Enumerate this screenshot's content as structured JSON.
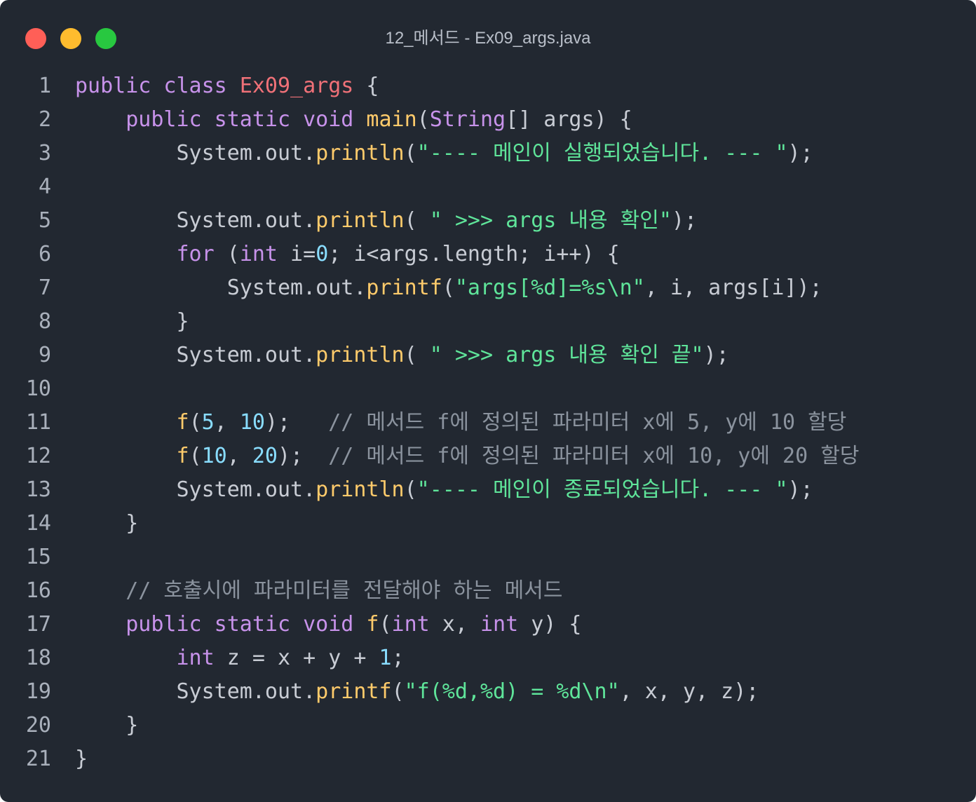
{
  "window": {
    "title": "12_메서드 - Ex09_args.java",
    "traffic_lights": [
      {
        "name": "close",
        "color": "#ff5f57"
      },
      {
        "name": "minimize",
        "color": "#febc2e"
      },
      {
        "name": "maximize",
        "color": "#28c840"
      }
    ]
  },
  "colors": {
    "background": "#222831",
    "keyword": "#c792ea",
    "class_name": "#f07178",
    "function": "#ffcb6b",
    "string": "#5fe59a",
    "number": "#89ddff",
    "comment": "#8b939e",
    "plain": "#c8ccd4"
  },
  "code": {
    "lines": [
      {
        "n": "1",
        "tokens": [
          {
            "t": "public class ",
            "k": "kw"
          },
          {
            "t": "Ex09_args",
            "k": "cls"
          },
          {
            "t": " {",
            "k": "plain"
          }
        ]
      },
      {
        "n": "2",
        "tokens": [
          {
            "t": "    ",
            "k": "plain"
          },
          {
            "t": "public static void ",
            "k": "kw"
          },
          {
            "t": "main",
            "k": "fn"
          },
          {
            "t": "(",
            "k": "plain"
          },
          {
            "t": "String",
            "k": "type"
          },
          {
            "t": "[] args) {",
            "k": "plain"
          }
        ]
      },
      {
        "n": "3",
        "tokens": [
          {
            "t": "        System.out.",
            "k": "plain"
          },
          {
            "t": "println",
            "k": "fn"
          },
          {
            "t": "(",
            "k": "plain"
          },
          {
            "t": "\"---- 메인이 실행되었습니다. --- \"",
            "k": "str"
          },
          {
            "t": ");",
            "k": "plain"
          }
        ]
      },
      {
        "n": "4",
        "tokens": []
      },
      {
        "n": "5",
        "tokens": [
          {
            "t": "        System.out.",
            "k": "plain"
          },
          {
            "t": "println",
            "k": "fn"
          },
          {
            "t": "( ",
            "k": "plain"
          },
          {
            "t": "\" >>> args 내용 확인\"",
            "k": "str"
          },
          {
            "t": ");",
            "k": "plain"
          }
        ]
      },
      {
        "n": "6",
        "tokens": [
          {
            "t": "        ",
            "k": "plain"
          },
          {
            "t": "for",
            "k": "kw"
          },
          {
            "t": " (",
            "k": "plain"
          },
          {
            "t": "int",
            "k": "kw"
          },
          {
            "t": " i=",
            "k": "plain"
          },
          {
            "t": "0",
            "k": "num"
          },
          {
            "t": "; i<args.length; i++) {",
            "k": "plain"
          }
        ]
      },
      {
        "n": "7",
        "tokens": [
          {
            "t": "            System.out.",
            "k": "plain"
          },
          {
            "t": "printf",
            "k": "fn"
          },
          {
            "t": "(",
            "k": "plain"
          },
          {
            "t": "\"args[%d]=%s\\n\"",
            "k": "str"
          },
          {
            "t": ", i, args[i]);",
            "k": "plain"
          }
        ]
      },
      {
        "n": "8",
        "tokens": [
          {
            "t": "        }",
            "k": "plain"
          }
        ]
      },
      {
        "n": "9",
        "tokens": [
          {
            "t": "        System.out.",
            "k": "plain"
          },
          {
            "t": "println",
            "k": "fn"
          },
          {
            "t": "( ",
            "k": "plain"
          },
          {
            "t": "\" >>> args 내용 확인 끝\"",
            "k": "str"
          },
          {
            "t": ");",
            "k": "plain"
          }
        ]
      },
      {
        "n": "10",
        "tokens": []
      },
      {
        "n": "11",
        "tokens": [
          {
            "t": "        ",
            "k": "plain"
          },
          {
            "t": "f",
            "k": "fn"
          },
          {
            "t": "(",
            "k": "plain"
          },
          {
            "t": "5",
            "k": "num"
          },
          {
            "t": ", ",
            "k": "plain"
          },
          {
            "t": "10",
            "k": "num"
          },
          {
            "t": ");   ",
            "k": "plain"
          },
          {
            "t": "// 메서드 f에 정의된 파라미터 x에 5, y에 10 할당",
            "k": "cm"
          }
        ]
      },
      {
        "n": "12",
        "tokens": [
          {
            "t": "        ",
            "k": "plain"
          },
          {
            "t": "f",
            "k": "fn"
          },
          {
            "t": "(",
            "k": "plain"
          },
          {
            "t": "10",
            "k": "num"
          },
          {
            "t": ", ",
            "k": "plain"
          },
          {
            "t": "20",
            "k": "num"
          },
          {
            "t": ");  ",
            "k": "plain"
          },
          {
            "t": "// 메서드 f에 정의된 파라미터 x에 10, y에 20 할당",
            "k": "cm"
          }
        ]
      },
      {
        "n": "13",
        "tokens": [
          {
            "t": "        System.out.",
            "k": "plain"
          },
          {
            "t": "println",
            "k": "fn"
          },
          {
            "t": "(",
            "k": "plain"
          },
          {
            "t": "\"---- 메인이 종료되었습니다. --- \"",
            "k": "str"
          },
          {
            "t": ");",
            "k": "plain"
          }
        ]
      },
      {
        "n": "14",
        "tokens": [
          {
            "t": "    }",
            "k": "plain"
          }
        ]
      },
      {
        "n": "15",
        "tokens": []
      },
      {
        "n": "16",
        "tokens": [
          {
            "t": "    ",
            "k": "plain"
          },
          {
            "t": "// 호출시에 파라미터를 전달해야 하는 메서드",
            "k": "cm"
          }
        ]
      },
      {
        "n": "17",
        "tokens": [
          {
            "t": "    ",
            "k": "plain"
          },
          {
            "t": "public static void ",
            "k": "kw"
          },
          {
            "t": "f",
            "k": "fn"
          },
          {
            "t": "(",
            "k": "plain"
          },
          {
            "t": "int",
            "k": "kw"
          },
          {
            "t": " x, ",
            "k": "plain"
          },
          {
            "t": "int",
            "k": "kw"
          },
          {
            "t": " y) {",
            "k": "plain"
          }
        ]
      },
      {
        "n": "18",
        "tokens": [
          {
            "t": "        ",
            "k": "plain"
          },
          {
            "t": "int",
            "k": "kw"
          },
          {
            "t": " z = x + y + ",
            "k": "plain"
          },
          {
            "t": "1",
            "k": "num"
          },
          {
            "t": ";",
            "k": "plain"
          }
        ]
      },
      {
        "n": "19",
        "tokens": [
          {
            "t": "        System.out.",
            "k": "plain"
          },
          {
            "t": "printf",
            "k": "fn"
          },
          {
            "t": "(",
            "k": "plain"
          },
          {
            "t": "\"f(%d,%d) = %d\\n\"",
            "k": "str"
          },
          {
            "t": ", x, y, z);",
            "k": "plain"
          }
        ]
      },
      {
        "n": "20",
        "tokens": [
          {
            "t": "    }",
            "k": "plain"
          }
        ]
      },
      {
        "n": "21",
        "tokens": [
          {
            "t": "}",
            "k": "plain"
          }
        ]
      }
    ]
  }
}
